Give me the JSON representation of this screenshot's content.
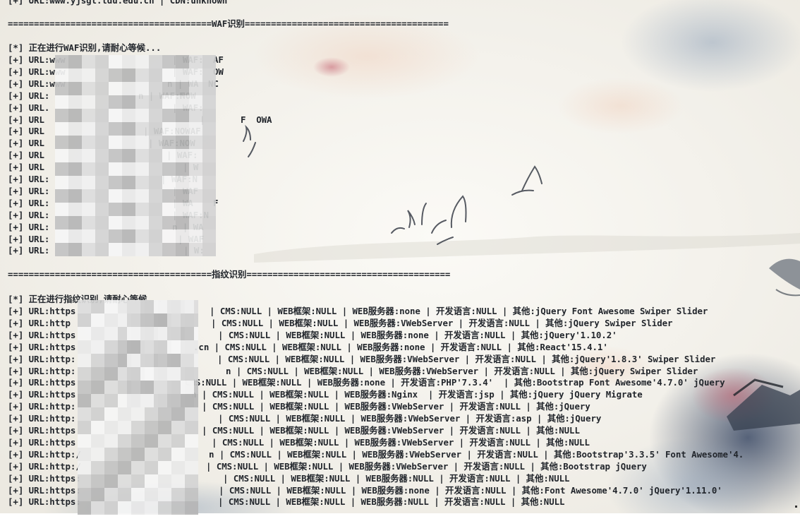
{
  "top_line": "[+] URL:www.yjsgl.tdu.edu.cn | CDN:unknown",
  "sections": {
    "waf": {
      "header": "=======================================WAF识别=======================================",
      "status": "[*] 正在进行WAF识别,请耐心等候...",
      "rows": [
        {
          "left": "[+] URL:www",
          "right": "| WAF:",
          "right_tail": "AF"
        },
        {
          "left": "[+] URL:www",
          "right": "| WAF:",
          "right_tail": "OW"
        },
        {
          "left": "[+] URL:www",
          "right": "n | WA",
          "right_tail": "NC"
        },
        {
          "left": "[+] URL:",
          "right": "n | WAF:NOW",
          "right_tail": "F"
        },
        {
          "left": "[+] URL.",
          "right": "| WAF:",
          "right_tail": ""
        },
        {
          "left": "[+] URL",
          "right": "| ",
          "right_tail": "F  OWA"
        },
        {
          "left": "[+] URL",
          "right": "| WAF:NOWAF",
          "right_tail": ""
        },
        {
          "left": "[+] URL",
          "right": "| WAF:NOW",
          "right_tail": ""
        },
        {
          "left": "[+] URL",
          "right": "| WAF:",
          "right_tail": ""
        },
        {
          "left": "[+] URL",
          "right": "| W",
          "right_tail": ""
        },
        {
          "left": "[+] URL:",
          "right": "| WAF:N",
          "right_tail": ""
        },
        {
          "left": "[+] URL:",
          "right": "| WAF",
          "right_tail": ""
        },
        {
          "left": "[+] URL:",
          "right": "| WA",
          "right_tail": "F"
        },
        {
          "left": "[+] URL:",
          "right": "| WAF:N",
          "right_tail": ""
        },
        {
          "left": "[+] URL:",
          "right": "n | WA",
          "right_tail": ""
        },
        {
          "left": "[+] URL:",
          "right": "| WAF",
          "right_tail": ""
        },
        {
          "left": "[+] URL:",
          "right": "| W:",
          "right_tail": ""
        }
      ]
    },
    "fingerprint": {
      "header": "=======================================指纹识别=======================================",
      "status": "[*] 正在进行指纹识别,请耐心等候...",
      "rows": [
        {
          "left": "[+] URL:https",
          "rest": "| CMS:NULL | WEB框架:NULL | WEB服务器:none | 开发语言:NULL | 其他:jQuery Font Awesome Swiper Slider"
        },
        {
          "left": "[+] URL:http",
          "rest": "| CMS:NULL | WEB框架:NULL | WEB服务器:VWebServer | 开发语言:NULL | 其他:jQuery Swiper Slider"
        },
        {
          "left": "[+] URL:https",
          "rest": "| CMS:NULL | WEB框架:NULL | WEB服务器:none | 开发语言:NULL | 其他:jQuery'1.10.2'"
        },
        {
          "left": "[+] URL:https",
          "rest": ".cn | CMS:NULL | WEB框架:NULL | WEB服务器:none | 开发语言:NULL | 其他:React'15.4.1'"
        },
        {
          "left": "[+] URL:http:",
          "rest": "| CMS:NULL | WEB框架:NULL | WEB服务器:VWebServer | 开发语言:NULL | 其他:jQuery'1.8.3' Swiper Slider"
        },
        {
          "left": "[+] URL:http:",
          "rest": "n | CMS:NULL | WEB框架:NULL | WEB服务器:VWebServer | 开发语言:NULL | 其他:jQuery Swiper Slider"
        },
        {
          "left": "[+] URL:https",
          "rest": "CMS:NULL | WEB框架:NULL | WEB服务器:none | 开发语言:PHP'7.3.4'  | 其他:Bootstrap Font Awesome'4.7.0' jQuery"
        },
        {
          "left": "[+] URL:https",
          "rest": "n | CMS:NULL | WEB框架:NULL | WEB服务器:Nginx  | 开发语言:jsp | 其他:jQuery jQuery Migrate"
        },
        {
          "left": "[+] URL:http:",
          "rest": "| CMS:NULL | WEB框架:NULL | WEB服务器:VWebServer | 开发语言:NULL | 其他:jQuery"
        },
        {
          "left": "[+] URL:http:",
          "rest": "| CMS:NULL | WEB框架:NULL | WEB服务器:VWebServer | 开发语言:asp | 其他:jQuery"
        },
        {
          "left": "[+] URL:https",
          "rest": "| CMS:NULL | WEB框架:NULL | WEB服务器:VWebServer | 开发语言:NULL | 其他:NULL"
        },
        {
          "left": "[+] URL:https",
          "rest": "| CMS:NULL | WEB框架:NULL | WEB服务器:VWebServer | 开发语言:NULL | 其他:NULL"
        },
        {
          "left": "[+] URL:http:/",
          "rest": "n | CMS:NULL | WEB框架:NULL | WEB服务器:VWebServer | 开发语言:NULL | 其他:Bootstrap'3.3.5' Font Awesome'4."
        },
        {
          "left": "[+] URL:http:/",
          "rest": "| CMS:NULL | WEB框架:NULL | WEB服务器:VWebServer | 开发语言:NULL | 其他:Bootstrap jQuery"
        },
        {
          "left": "[+] URL:https:",
          "rest": "| CMS:NULL | WEB框架:NULL | WEB服务器:NULL | 开发语言:NULL | 其他:NULL"
        },
        {
          "left": "[+] URL:https:",
          "rest": "| CMS:NULL | WEB框架:NULL | WEB服务器:none | 开发语言:NULL | 其他:Font Awesome'4.7.0' jQuery'1.11.0'"
        },
        {
          "left": "[+] URL:https:",
          "rest": "| CMS:NULL | WEB框架:NULL | WEB服务器:NULL | 开发语言:NULL | 其他:NULL"
        }
      ]
    }
  },
  "colors": {
    "text": "#22262c",
    "bg": "#f3f1ec",
    "mosaic": [
      "#f5f5f5",
      "#e8e8e8",
      "#dcdcdc",
      "#cfcfcf",
      "#c2c2c2",
      "#b5b5b5",
      "#f0f0f0",
      "#d4d4d4"
    ]
  }
}
